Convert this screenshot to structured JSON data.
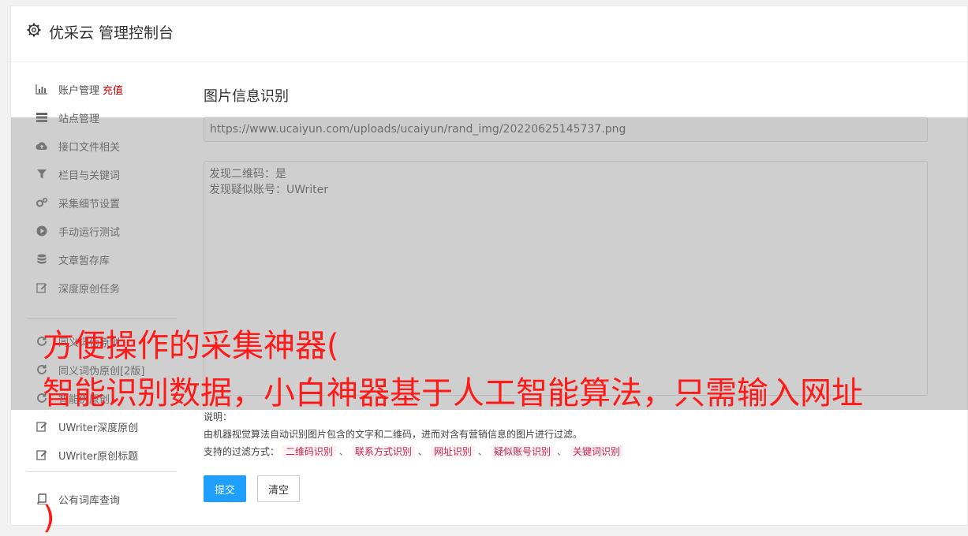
{
  "header": {
    "title": "优采云 管理控制台"
  },
  "sidebar": {
    "items": [
      {
        "label": "账户管理",
        "extra": "充值",
        "icon": "bar-chart-icon"
      },
      {
        "label": "站点管理",
        "icon": "server-icon"
      },
      {
        "label": "接口文件相关",
        "icon": "cloud-upload-icon"
      },
      {
        "label": "栏目与关键词",
        "icon": "filter-icon"
      },
      {
        "label": "采集细节设置",
        "icon": "gears-icon"
      },
      {
        "label": "手动运行测试",
        "icon": "play-circle-icon"
      },
      {
        "label": "文章暂存库",
        "icon": "database-icon"
      },
      {
        "label": "深度原创任务",
        "icon": "edit-icon"
      },
      {
        "label": "同义词伪原创",
        "icon": "refresh-icon"
      },
      {
        "label": "同义词伪原创[2版]",
        "icon": "refresh-icon"
      },
      {
        "label": "智能伪原创",
        "icon": "refresh-icon"
      },
      {
        "label": "UWriter深度原创",
        "icon": "edit-icon"
      },
      {
        "label": "UWriter原创标题",
        "icon": "edit-icon"
      },
      {
        "label": "公有词库查询",
        "icon": "book-icon"
      }
    ]
  },
  "main": {
    "title": "图片信息识别",
    "url_value": "https://www.ucaiyun.com/uploads/ucaiyun/rand_img/20220625145737.png",
    "result_lines": [
      "发现二维码：是",
      "发现疑似账号：UWriter"
    ],
    "desc_label": "说明：",
    "desc_text": "由机器视觉算法自动识别图片包含的文字和二维码，进而对含有营销信息的图片进行过滤。",
    "filter_label": "支持的过滤方式：",
    "filter_tags": [
      "二维码识别",
      "联系方式识别",
      "网址识别",
      "疑似账号识别",
      "关键词识别"
    ],
    "filter_sep": "、",
    "submit_label": "提交",
    "clear_label": "清空"
  },
  "overlay": {
    "line1": "方便操作的采集神器(",
    "line2": "智能识别数据，小白神器基于人工智能算法，只需输入网址",
    "line3": ")"
  }
}
